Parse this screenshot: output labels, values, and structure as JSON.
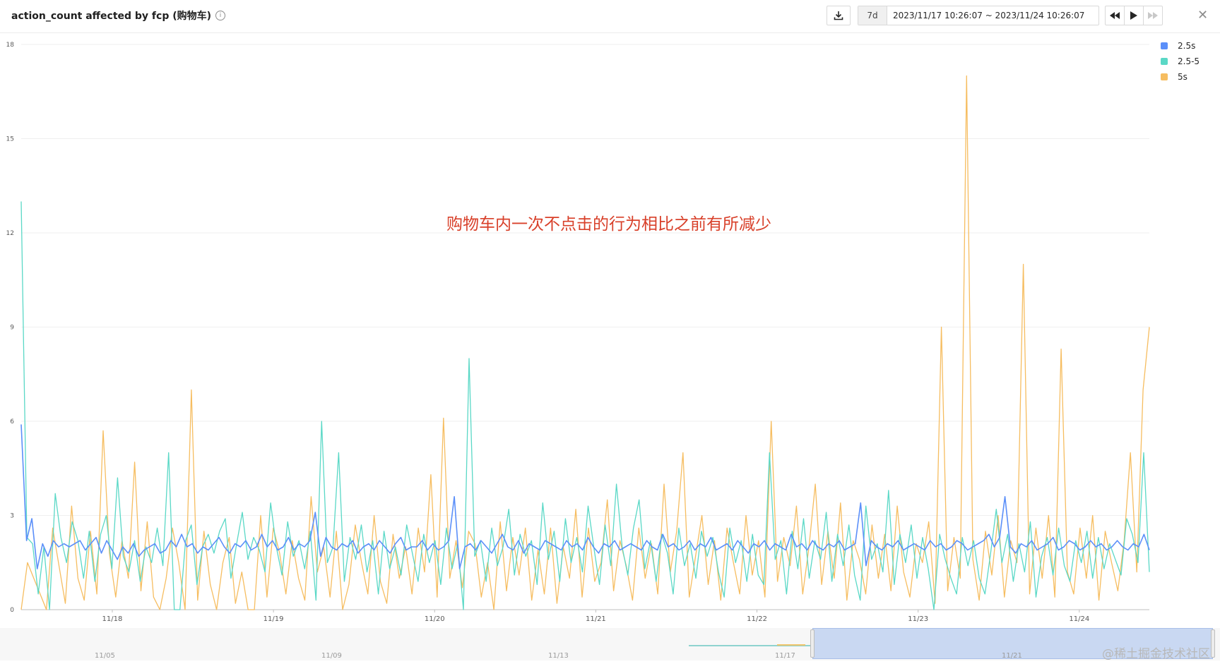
{
  "header": {
    "title": "action_count affected by fcp (购物车)",
    "info_icon": "i",
    "range_preset": "7d",
    "range_text": "2023/11/17 10:26:07 ~ 2023/11/24 10:26:07",
    "icons": {
      "download": "download-icon",
      "prev": "rewind-icon",
      "play": "play-icon",
      "next": "fast-forward-icon",
      "close": "close-icon"
    },
    "close_glyph": "✕"
  },
  "annotation": "购物车内一次不点击的行为相比之前有所减少",
  "brush": {
    "ticks": [
      "11/05",
      "11/09",
      "11/13",
      "11/17",
      "11/21"
    ]
  },
  "watermark": "@稀土掘金技术社区",
  "chart_data": {
    "type": "line",
    "title": "action_count affected by fcp (购物车)",
    "xlabel": "",
    "ylabel": "",
    "x_ticks": [
      "11/18",
      "11/19",
      "11/20",
      "11/21",
      "11/22",
      "11/23",
      "11/24"
    ],
    "x_range": [
      "2023/11/17 10:26:07",
      "2023/11/24 10:26:07"
    ],
    "y_ticks": [
      0,
      3,
      6,
      9,
      12,
      15,
      18
    ],
    "ylim": [
      0,
      18
    ],
    "grid": true,
    "legend_position": "top-right",
    "series": [
      {
        "name": "2.5s",
        "color": "#5b8ff9",
        "values": [
          5.9,
          2.2,
          2.9,
          1.3,
          2.1,
          1.7,
          2.2,
          2.0,
          2.1,
          2.0,
          2.1,
          2.2,
          1.9,
          2.1,
          2.3,
          1.8,
          2.2,
          1.9,
          1.6,
          2.0,
          1.8,
          2.1,
          1.7,
          1.9,
          2.0,
          2.1,
          1.8,
          1.9,
          2.2,
          2.0,
          2.4,
          2.0,
          2.1,
          1.8,
          2.0,
          1.9,
          2.1,
          2.3,
          2.0,
          1.8,
          2.1,
          2.0,
          2.2,
          1.9,
          2.0,
          2.4,
          2.0,
          2.2,
          1.9,
          2.0,
          2.3,
          1.9,
          2.1,
          2.0,
          2.2,
          3.1,
          1.7,
          2.3,
          2.0,
          1.9,
          2.1,
          2.0,
          2.2,
          1.8,
          2.0,
          2.1,
          1.9,
          2.2,
          2.0,
          1.8,
          2.1,
          2.3,
          1.9,
          2.0,
          2.0,
          2.2,
          1.9,
          2.1,
          1.9,
          2.0,
          2.2,
          3.6,
          1.3,
          2.0,
          2.1,
          1.9,
          2.2,
          2.0,
          1.8,
          2.1,
          2.4,
          2.0,
          1.9,
          2.2,
          1.8,
          2.1,
          2.0,
          1.9,
          2.2,
          2.1,
          2.0,
          1.9,
          2.2,
          2.0,
          2.1,
          1.9,
          2.3,
          2.0,
          1.8,
          2.1,
          2.0,
          2.2,
          1.9,
          2.0,
          2.1,
          2.0,
          1.9,
          2.2,
          2.0,
          1.9,
          2.4,
          2.0,
          2.1,
          1.9,
          2.0,
          2.2,
          1.9,
          2.1,
          2.0,
          2.3,
          1.9,
          2.0,
          2.1,
          1.9,
          2.2,
          2.0,
          1.8,
          2.1,
          2.0,
          2.2,
          1.9,
          2.1,
          2.0,
          1.9,
          2.4,
          2.0,
          2.1,
          1.9,
          2.2,
          2.0,
          1.9,
          2.1,
          2.0,
          2.2,
          1.9,
          2.0,
          2.1,
          3.4,
          1.4,
          2.2,
          2.0,
          1.9,
          2.1,
          2.0,
          2.2,
          1.9,
          2.0,
          2.1,
          2.0,
          1.9,
          2.2,
          2.0,
          2.1,
          1.9,
          2.0,
          2.2,
          2.1,
          1.9,
          2.0,
          2.1,
          2.2,
          2.4,
          2.0,
          2.3,
          3.6,
          2.0,
          1.8,
          2.1,
          2.0,
          2.2,
          1.9,
          2.0,
          2.1,
          2.3,
          1.9,
          2.0,
          2.2,
          2.1,
          1.9,
          2.0,
          2.2,
          2.0,
          2.1,
          1.9,
          2.0,
          2.2,
          2.0,
          1.9,
          2.1,
          2.0,
          2.4,
          1.9
        ]
      },
      {
        "name": "2.5-5",
        "color": "#5ad8c6",
        "values": [
          13,
          2.3,
          2.1,
          0.5,
          2.0,
          0,
          3.7,
          2.3,
          1.5,
          2.8,
          2.2,
          1.0,
          2.5,
          0.9,
          2.4,
          3.0,
          1.3,
          4.2,
          1.7,
          1.2,
          2.2,
          0.9,
          2.0,
          1.5,
          2.6,
          1.4,
          5.0,
          0,
          0,
          2.2,
          2.7,
          0.8,
          2.0,
          2.4,
          1.8,
          2.5,
          2.9,
          1.0,
          2.1,
          3.1,
          1.6,
          2.3,
          1.9,
          1.2,
          3.4,
          2.0,
          1.1,
          2.8,
          1.7,
          2.2,
          1.3,
          2.5,
          0.3,
          6.0,
          1.5,
          2.0,
          5.0,
          0.9,
          2.3,
          1.6,
          2.7,
          1.2,
          2.2,
          0.5,
          2.5,
          1.3,
          2.0,
          1.1,
          2.7,
          1.8,
          0.9,
          2.4,
          1.5,
          2.2,
          0.8,
          2.6,
          1.3,
          2.1,
          0,
          8.0,
          1.7,
          2.2,
          0.9,
          2.6,
          1.4,
          2.0,
          3.2,
          1.1,
          2.4,
          1.7,
          2.2,
          0.8,
          3.4,
          1.6,
          2.5,
          0.9,
          2.9,
          1.5,
          2.3,
          1.2,
          3.3,
          2.0,
          0.8,
          2.7,
          1.4,
          4.0,
          2.0,
          1.1,
          2.6,
          3.5,
          1.3,
          2.2,
          0.9,
          2.4,
          1.8,
          0.5,
          2.6,
          1.4,
          2.1,
          1.0,
          2.5,
          1.7,
          2.3,
          1.2,
          0.4,
          2.6,
          1.5,
          2.2,
          0.9,
          2.4,
          1.1,
          0.8,
          5.0,
          1.6,
          2.2,
          0.5,
          2.5,
          1.3,
          2.9,
          1.0,
          2.2,
          1.6,
          3.1,
          0.9,
          2.4,
          1.4,
          2.7,
          1.1,
          0.3,
          3.3,
          1.6,
          2.1,
          1.2,
          3.8,
          0.8,
          2.4,
          1.5,
          2.7,
          1.0,
          2.3,
          1.3,
          0,
          2.4,
          1.6,
          1.0,
          0.5,
          2.3,
          1.4,
          2.2,
          1.0,
          0.5,
          1.8,
          3.2,
          1.5,
          2.4,
          0.9,
          2.1,
          1.2,
          2.8,
          0.4,
          1.7,
          2.3,
          1.1,
          2.6,
          1.4,
          0.9,
          2.2,
          1.5,
          2.5,
          1.0,
          2.3,
          1.3,
          2.1,
          1.6,
          1.1,
          2.9,
          2.4,
          1.5,
          5.0,
          1.2
        ]
      },
      {
        "name": "5s",
        "color": "#f6bd60",
        "values": [
          0,
          1.5,
          1.0,
          0.5,
          0,
          2.6,
          1.4,
          0.2,
          3.3,
          1.0,
          0.3,
          2.5,
          0.5,
          5.7,
          1.8,
          0.4,
          2.2,
          1.0,
          4.7,
          0.6,
          2.8,
          0.4,
          0,
          1.0,
          2.6,
          1.5,
          0,
          7.0,
          0.3,
          2.5,
          0.8,
          0,
          1.5,
          2.3,
          0.2,
          1.2,
          0,
          0,
          3.0,
          0.4,
          2.6,
          1.8,
          0.5,
          2.2,
          1.0,
          0.3,
          3.6,
          1.2,
          2.0,
          0.4,
          2.5,
          0,
          0.8,
          2.7,
          1.5,
          0.5,
          3.0,
          0.9,
          0.2,
          2.4,
          1.0,
          2.0,
          0.5,
          2.6,
          1.2,
          4.3,
          0.4,
          6.1,
          1.0,
          2.2,
          0.7,
          2.5,
          2.1,
          0.4,
          1.5,
          0,
          2.8,
          0.6,
          2.3,
          1.1,
          2.6,
          0.3,
          1.9,
          0.5,
          2.6,
          0.2,
          2.0,
          1.0,
          3.2,
          0.4,
          2.6,
          0.9,
          1.5,
          3.5,
          0.6,
          2.2,
          1.4,
          0.3,
          2.6,
          1.0,
          2.1,
          0.5,
          4.0,
          1.2,
          2.5,
          5.0,
          0.4,
          1.7,
          3.0,
          0.8,
          2.2,
          0.3,
          2.6,
          1.5,
          0.5,
          3.0,
          1.1,
          2.2,
          0.4,
          6.0,
          0.9,
          2.3,
          1.4,
          3.3,
          0.5,
          2.0,
          4.0,
          0.8,
          2.5,
          1.0,
          3.4,
          0.3,
          2.2,
          1.6,
          0.5,
          2.7,
          1.0,
          2.4,
          0.6,
          3.3,
          1.2,
          0.4,
          2.1,
          1.5,
          2.8,
          0.2,
          9.0,
          0.6,
          2.3,
          1.0,
          17.0,
          1.6,
          0.3,
          2.5,
          1.1,
          3.0,
          0.4,
          2.2,
          1.5,
          11.0,
          0.5,
          2.6,
          1.0,
          3.0,
          0.4,
          8.3,
          1.2,
          0.5,
          2.6,
          1.0,
          3.0,
          0.3,
          2.5,
          1.5,
          0.6,
          2.2,
          5.0,
          1.2,
          7.0,
          9.0
        ]
      }
    ]
  }
}
